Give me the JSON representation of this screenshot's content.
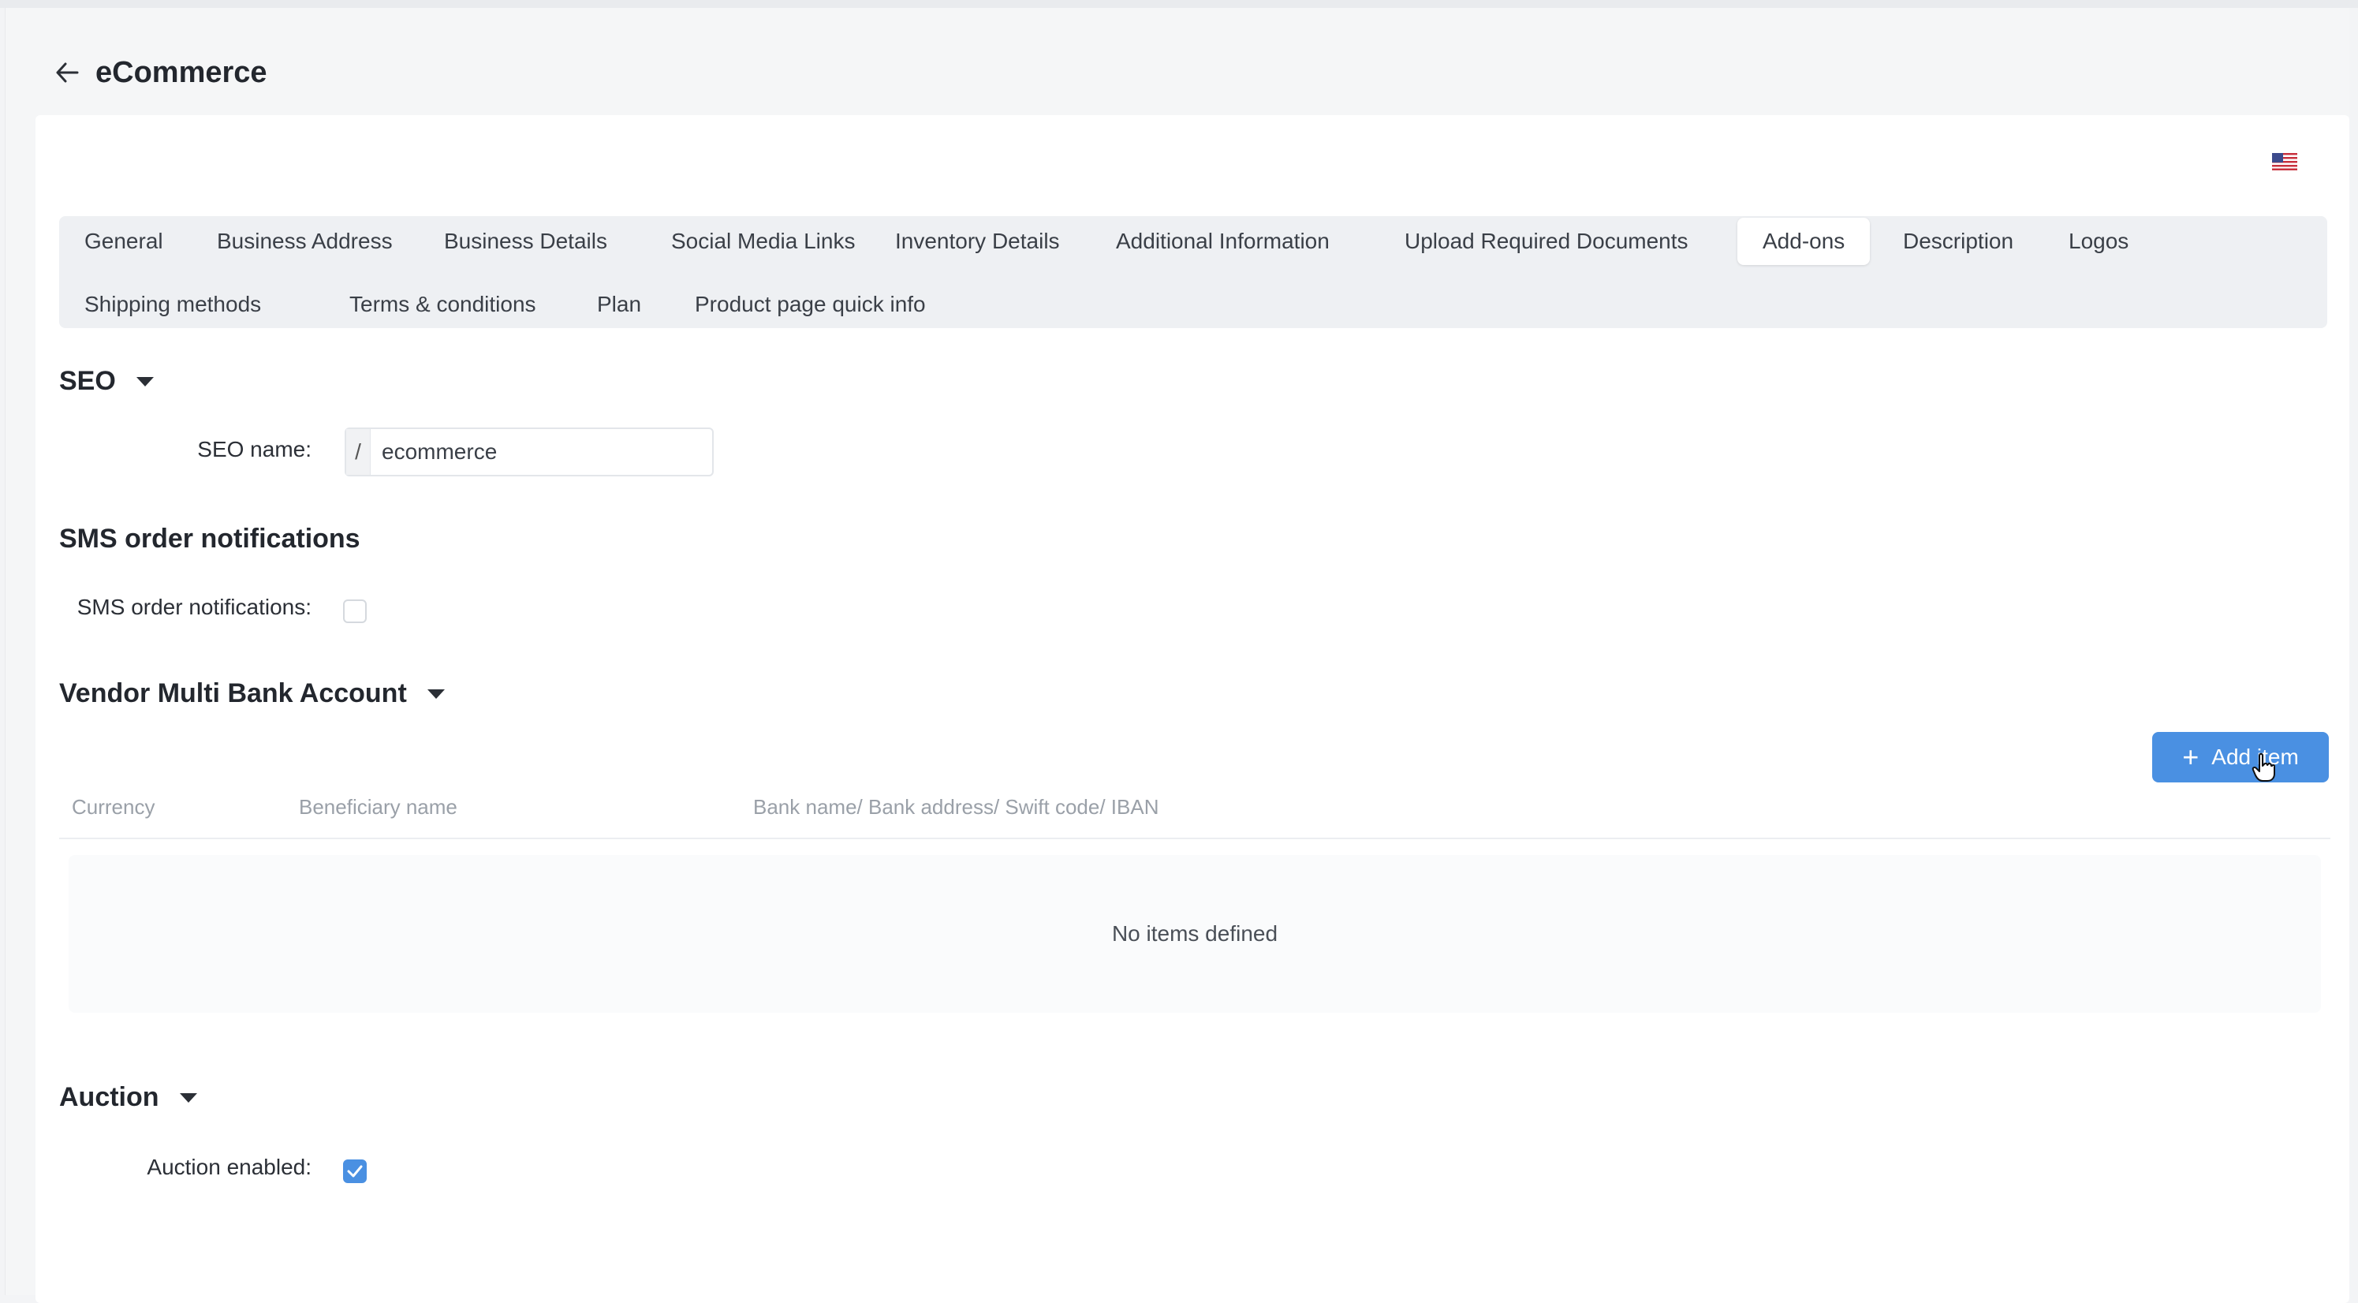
{
  "header": {
    "title": "eCommerce",
    "back_icon": "arrow-left-icon"
  },
  "language": {
    "icon": "us-flag-icon"
  },
  "tabs": [
    {
      "label": "General"
    },
    {
      "label": "Business Address"
    },
    {
      "label": "Business Details"
    },
    {
      "label": "Social Media Links"
    },
    {
      "label": "Inventory Details"
    },
    {
      "label": "Additional Information"
    },
    {
      "label": "Upload Required Documents"
    },
    {
      "label": "Add-ons",
      "active": true
    },
    {
      "label": "Description"
    },
    {
      "label": "Logos"
    },
    {
      "label": "Shipping methods"
    },
    {
      "label": "Terms & conditions"
    },
    {
      "label": "Plan"
    },
    {
      "label": "Product page quick info"
    }
  ],
  "seo": {
    "title": "SEO",
    "name_label": "SEO name:",
    "prefix": "/",
    "value": "ecommerce"
  },
  "sms": {
    "title": "SMS order notifications",
    "label": "SMS order notifications:",
    "checked": false
  },
  "bank": {
    "title": "Vendor Multi Bank Account",
    "add_button": "Add item",
    "columns": [
      "Currency",
      "Beneficiary name",
      "Bank name/ Bank address/ Swift code/ IBAN"
    ],
    "empty_text": "No items defined"
  },
  "auction": {
    "title": "Auction",
    "enabled_label": "Auction enabled:",
    "checked": true
  },
  "colors": {
    "accent": "#4a90e2",
    "tab_bar": "#eef0f3",
    "background": "#f5f6f7"
  }
}
